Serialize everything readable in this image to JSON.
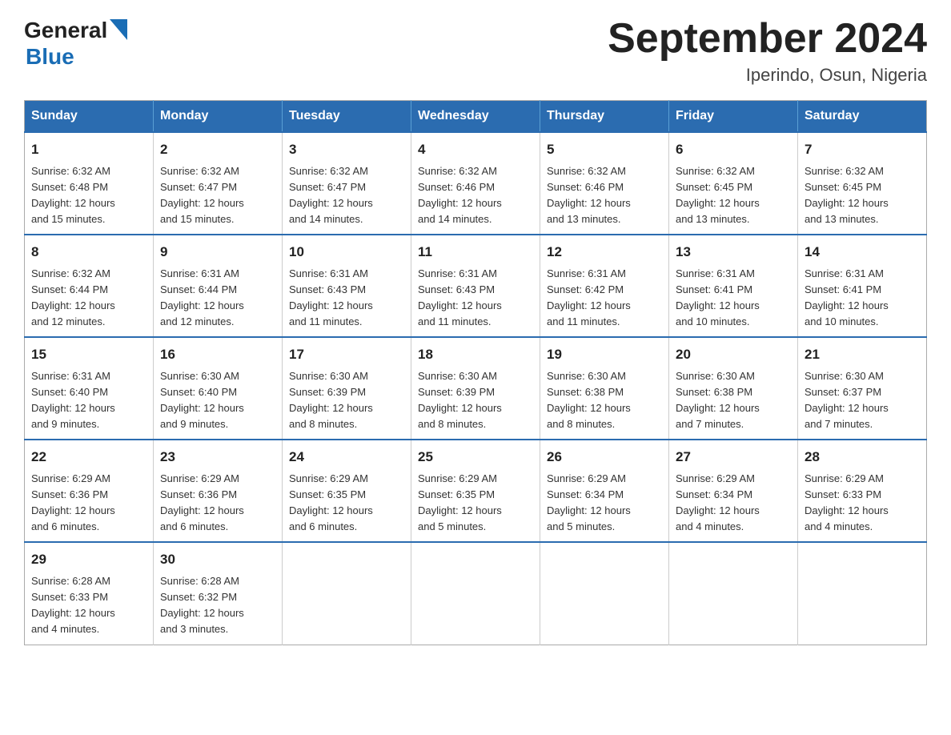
{
  "header": {
    "logo": {
      "general": "General",
      "triangle": "▶",
      "blue": "Blue"
    },
    "title": "September 2024",
    "subtitle": "Iperindo, Osun, Nigeria"
  },
  "days_of_week": [
    "Sunday",
    "Monday",
    "Tuesday",
    "Wednesday",
    "Thursday",
    "Friday",
    "Saturday"
  ],
  "weeks": [
    [
      {
        "day": "1",
        "sunrise": "6:32 AM",
        "sunset": "6:48 PM",
        "daylight": "12 hours and 15 minutes."
      },
      {
        "day": "2",
        "sunrise": "6:32 AM",
        "sunset": "6:47 PM",
        "daylight": "12 hours and 15 minutes."
      },
      {
        "day": "3",
        "sunrise": "6:32 AM",
        "sunset": "6:47 PM",
        "daylight": "12 hours and 14 minutes."
      },
      {
        "day": "4",
        "sunrise": "6:32 AM",
        "sunset": "6:46 PM",
        "daylight": "12 hours and 14 minutes."
      },
      {
        "day": "5",
        "sunrise": "6:32 AM",
        "sunset": "6:46 PM",
        "daylight": "12 hours and 13 minutes."
      },
      {
        "day": "6",
        "sunrise": "6:32 AM",
        "sunset": "6:45 PM",
        "daylight": "12 hours and 13 minutes."
      },
      {
        "day": "7",
        "sunrise": "6:32 AM",
        "sunset": "6:45 PM",
        "daylight": "12 hours and 13 minutes."
      }
    ],
    [
      {
        "day": "8",
        "sunrise": "6:32 AM",
        "sunset": "6:44 PM",
        "daylight": "12 hours and 12 minutes."
      },
      {
        "day": "9",
        "sunrise": "6:31 AM",
        "sunset": "6:44 PM",
        "daylight": "12 hours and 12 minutes."
      },
      {
        "day": "10",
        "sunrise": "6:31 AM",
        "sunset": "6:43 PM",
        "daylight": "12 hours and 11 minutes."
      },
      {
        "day": "11",
        "sunrise": "6:31 AM",
        "sunset": "6:43 PM",
        "daylight": "12 hours and 11 minutes."
      },
      {
        "day": "12",
        "sunrise": "6:31 AM",
        "sunset": "6:42 PM",
        "daylight": "12 hours and 11 minutes."
      },
      {
        "day": "13",
        "sunrise": "6:31 AM",
        "sunset": "6:41 PM",
        "daylight": "12 hours and 10 minutes."
      },
      {
        "day": "14",
        "sunrise": "6:31 AM",
        "sunset": "6:41 PM",
        "daylight": "12 hours and 10 minutes."
      }
    ],
    [
      {
        "day": "15",
        "sunrise": "6:31 AM",
        "sunset": "6:40 PM",
        "daylight": "12 hours and 9 minutes."
      },
      {
        "day": "16",
        "sunrise": "6:30 AM",
        "sunset": "6:40 PM",
        "daylight": "12 hours and 9 minutes."
      },
      {
        "day": "17",
        "sunrise": "6:30 AM",
        "sunset": "6:39 PM",
        "daylight": "12 hours and 8 minutes."
      },
      {
        "day": "18",
        "sunrise": "6:30 AM",
        "sunset": "6:39 PM",
        "daylight": "12 hours and 8 minutes."
      },
      {
        "day": "19",
        "sunrise": "6:30 AM",
        "sunset": "6:38 PM",
        "daylight": "12 hours and 8 minutes."
      },
      {
        "day": "20",
        "sunrise": "6:30 AM",
        "sunset": "6:38 PM",
        "daylight": "12 hours and 7 minutes."
      },
      {
        "day": "21",
        "sunrise": "6:30 AM",
        "sunset": "6:37 PM",
        "daylight": "12 hours and 7 minutes."
      }
    ],
    [
      {
        "day": "22",
        "sunrise": "6:29 AM",
        "sunset": "6:36 PM",
        "daylight": "12 hours and 6 minutes."
      },
      {
        "day": "23",
        "sunrise": "6:29 AM",
        "sunset": "6:36 PM",
        "daylight": "12 hours and 6 minutes."
      },
      {
        "day": "24",
        "sunrise": "6:29 AM",
        "sunset": "6:35 PM",
        "daylight": "12 hours and 6 minutes."
      },
      {
        "day": "25",
        "sunrise": "6:29 AM",
        "sunset": "6:35 PM",
        "daylight": "12 hours and 5 minutes."
      },
      {
        "day": "26",
        "sunrise": "6:29 AM",
        "sunset": "6:34 PM",
        "daylight": "12 hours and 5 minutes."
      },
      {
        "day": "27",
        "sunrise": "6:29 AM",
        "sunset": "6:34 PM",
        "daylight": "12 hours and 4 minutes."
      },
      {
        "day": "28",
        "sunrise": "6:29 AM",
        "sunset": "6:33 PM",
        "daylight": "12 hours and 4 minutes."
      }
    ],
    [
      {
        "day": "29",
        "sunrise": "6:28 AM",
        "sunset": "6:33 PM",
        "daylight": "12 hours and 4 minutes."
      },
      {
        "day": "30",
        "sunrise": "6:28 AM",
        "sunset": "6:32 PM",
        "daylight": "12 hours and 3 minutes."
      },
      null,
      null,
      null,
      null,
      null
    ]
  ],
  "labels": {
    "sunrise": "Sunrise:",
    "sunset": "Sunset:",
    "daylight": "Daylight:"
  }
}
